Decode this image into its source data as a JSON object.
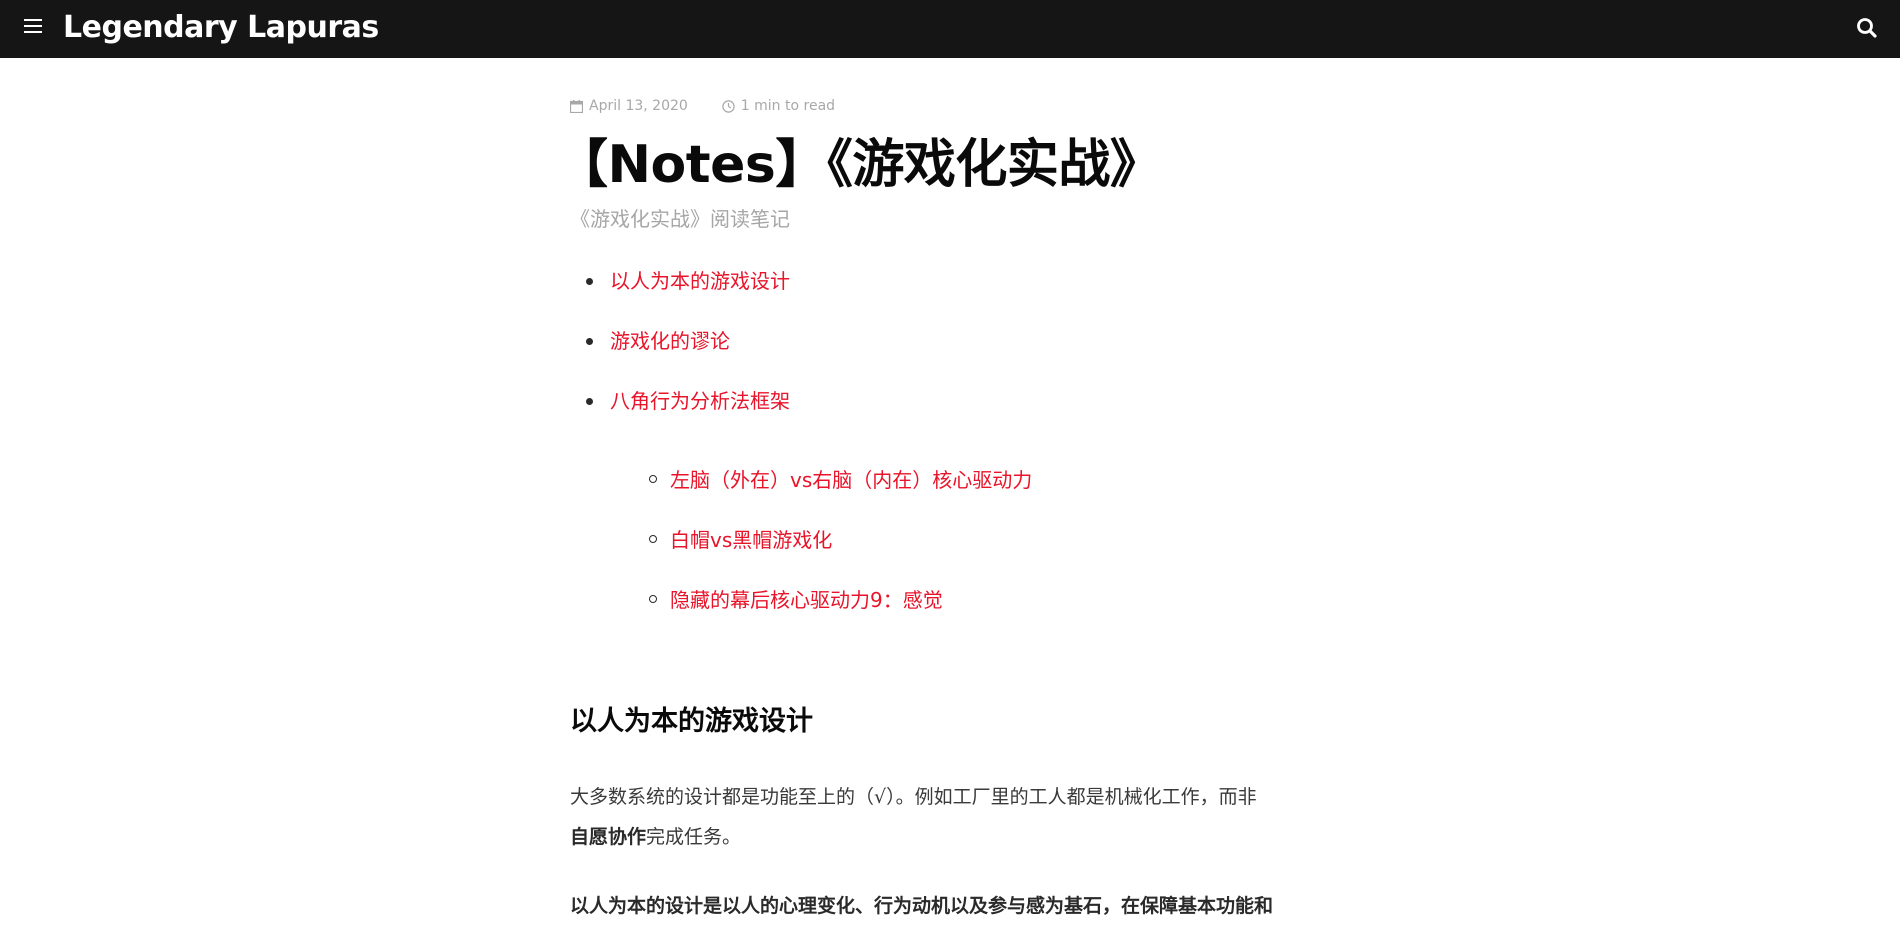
{
  "header": {
    "site_title": "Legendary Lapuras",
    "menu_icon": "menu-icon",
    "search_icon": "search-icon",
    "background": "#151515"
  },
  "post": {
    "date": "April 13, 2020",
    "read_time": "1 min to read",
    "title": "【Notes】《游戏化实战》",
    "subtitle": "《游戏化实战》阅读笔记"
  },
  "toc": {
    "items": [
      "以人为本的游戏设计",
      "游戏化的谬论",
      "八角行为分析法框架"
    ],
    "sub_items": [
      "左脑（外在）vs右脑（内在）核心驱动力",
      "白帽vs黑帽游戏化",
      "隐藏的幕后核心驱动力9：感觉"
    ],
    "link_color": "#e8142a"
  },
  "section": {
    "heading": "以人为本的游戏设计",
    "para1_line1": "大多数系统的设计都是功能至上的（√）。例如工厂里的工人都是机械化工作，而非",
    "para1_bold": "自愿协作",
    "para1_rest": "完成任务。",
    "para2": "以人为本的设计是以人的心理变化、行为动机以及参与感为基石，在保障基本功能和"
  }
}
